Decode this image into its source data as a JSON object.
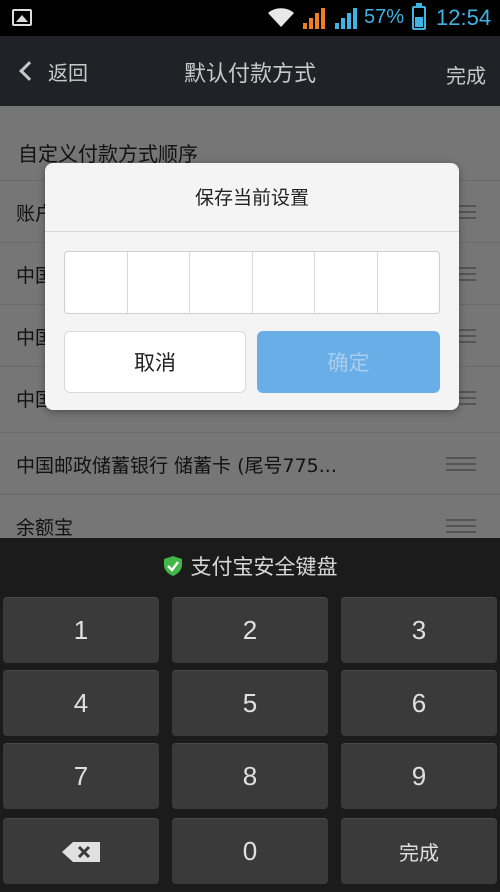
{
  "status_bar": {
    "battery_percent": "57%",
    "battery_level": 0.57,
    "time": "12:54"
  },
  "header": {
    "back_label": "返回",
    "title": "默认付款方式",
    "done_label": "完成"
  },
  "list": {
    "section_title": "自定义付款方式顺序",
    "rows": [
      {
        "label": "账户"
      },
      {
        "label": "中国"
      },
      {
        "label": "中国"
      },
      {
        "label": "中国"
      },
      {
        "label": "中国邮政储蓄银行 储蓄卡 (尾号775..."
      },
      {
        "label": "余额宝"
      }
    ]
  },
  "dialog": {
    "title": "保存当前设置",
    "pin_length": 6,
    "cancel_label": "取消",
    "confirm_label": "确定"
  },
  "keyboard": {
    "title": "支付宝安全键盘",
    "keys": [
      "1",
      "2",
      "3",
      "4",
      "5",
      "6",
      "7",
      "8",
      "9",
      "",
      "0",
      "完成"
    ]
  },
  "colors": {
    "accent": "#3fb3e3",
    "confirm_button": "#6aaee8",
    "shield": "#43b649"
  }
}
